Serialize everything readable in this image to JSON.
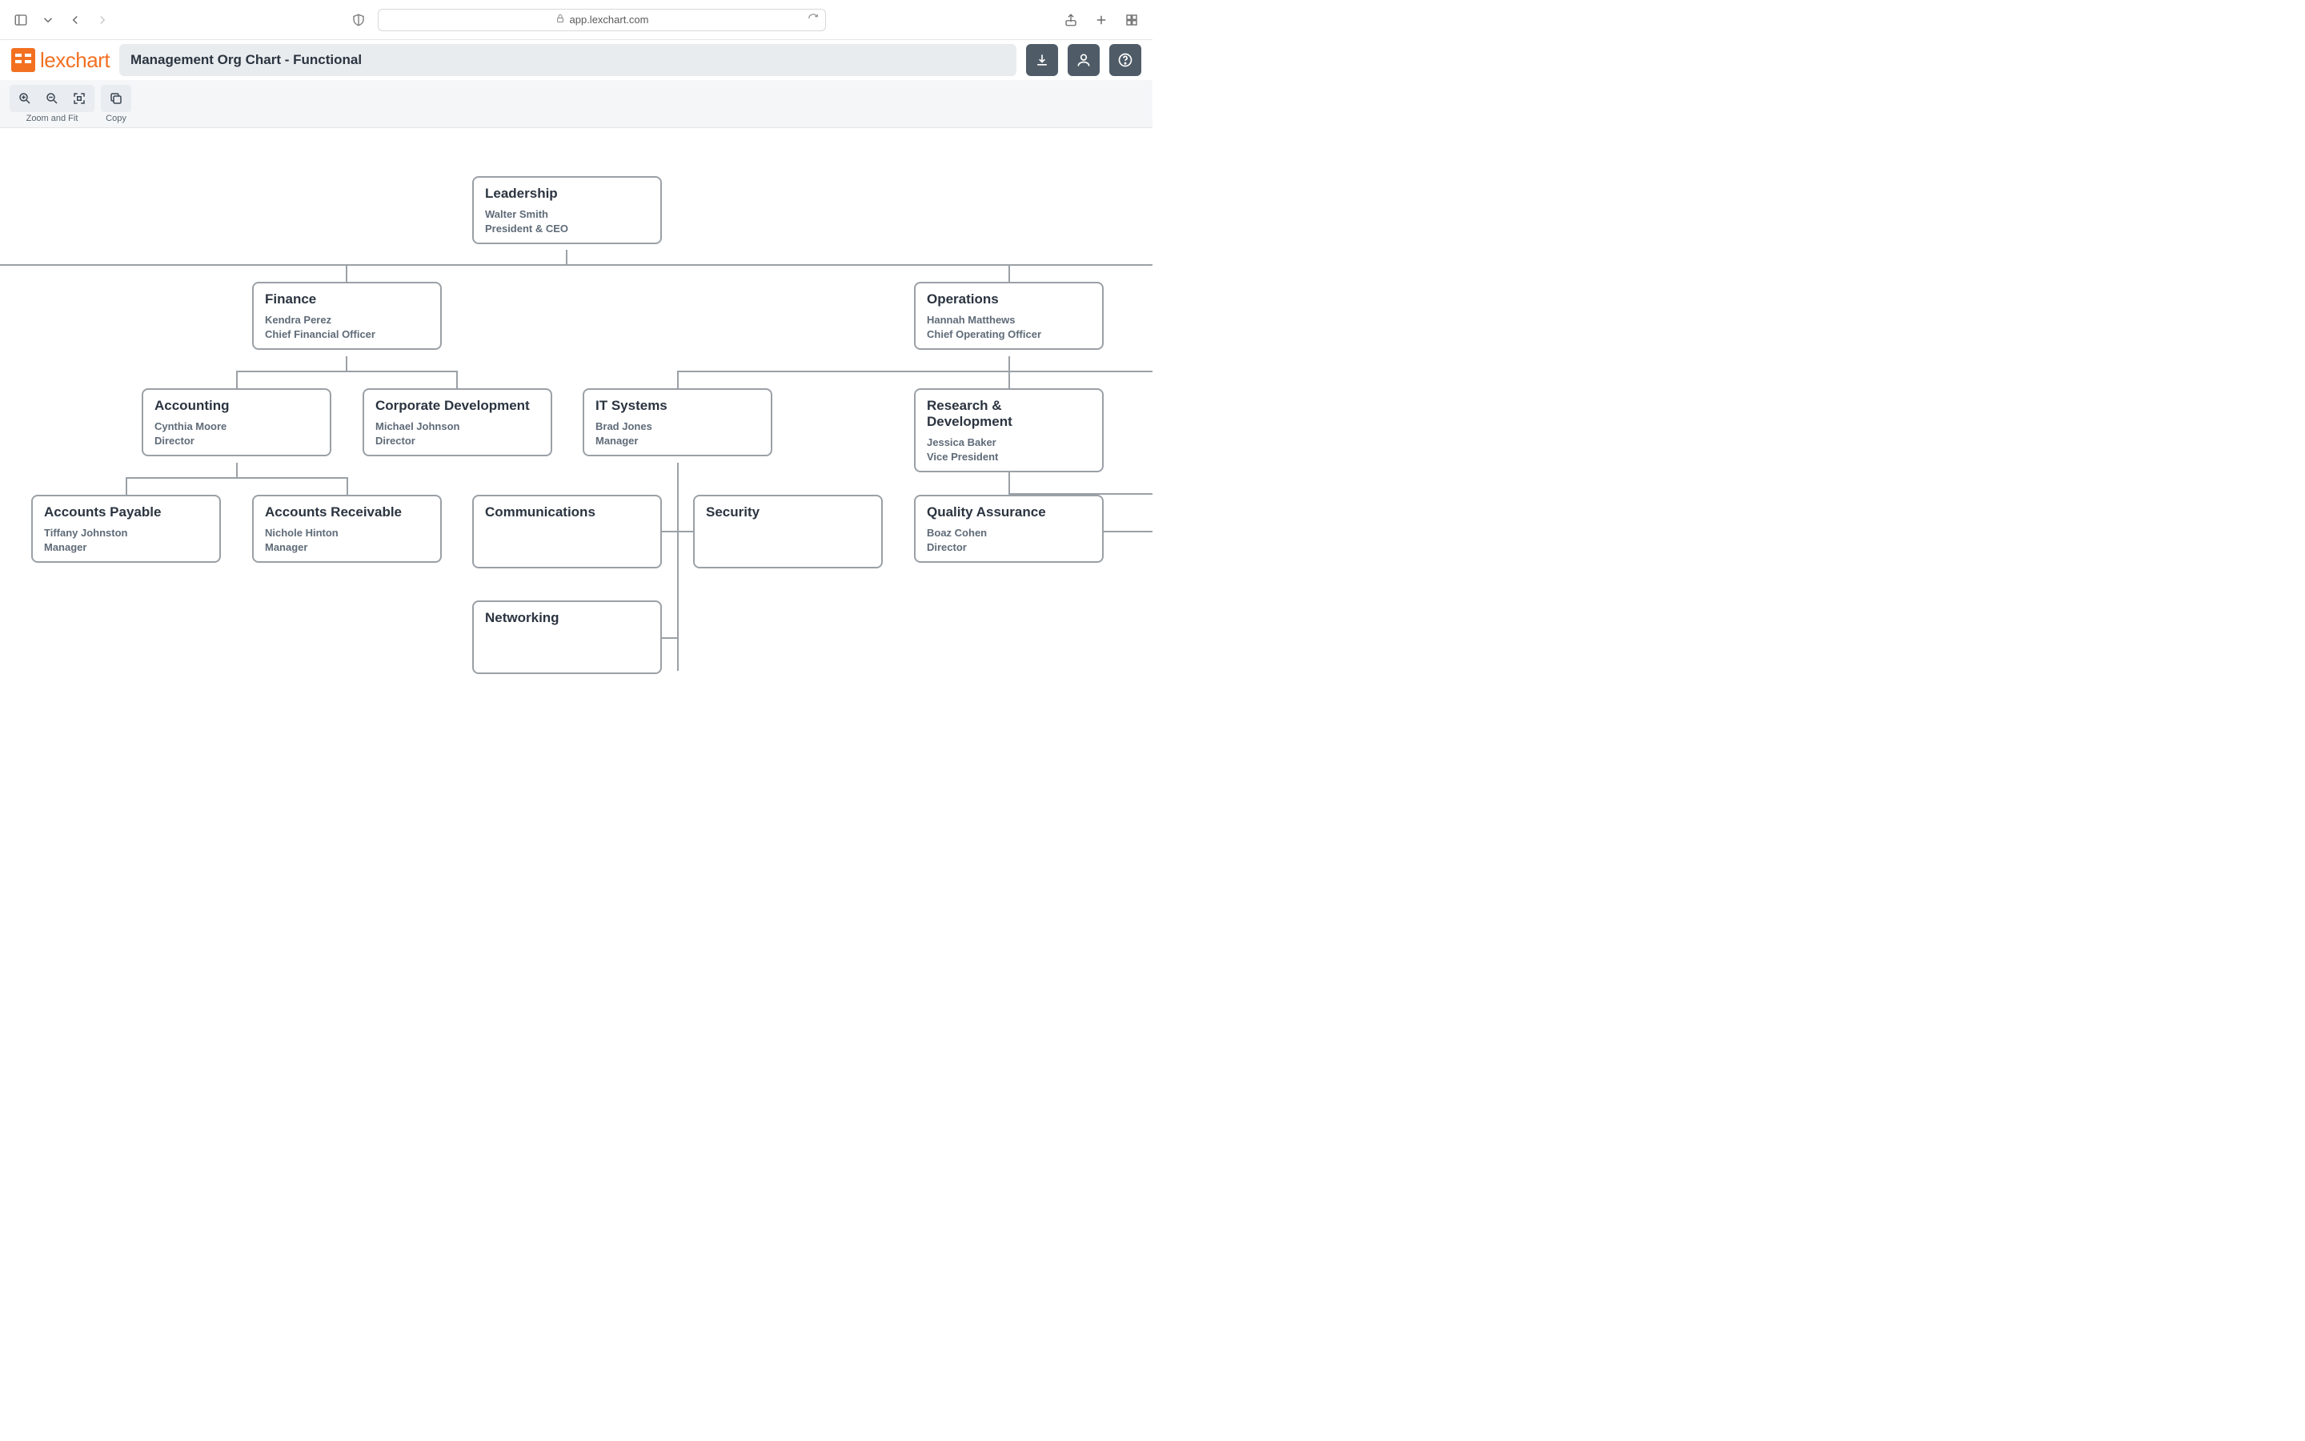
{
  "browser": {
    "url_host": "app.lexchart.com"
  },
  "app": {
    "logo_text": "lexchart",
    "title": "Management Org Chart - Functional"
  },
  "toolbar": {
    "zoom_label": "Zoom and Fit",
    "copy_label": "Copy"
  },
  "chart_data": {
    "type": "org-chart",
    "nodes": [
      {
        "id": "leadership",
        "dept": "Leadership",
        "person": "Walter Smith",
        "role": "President & CEO",
        "parent": null
      },
      {
        "id": "finance",
        "dept": "Finance",
        "person": "Kendra Perez",
        "role": "Chief Financial Officer",
        "parent": "leadership"
      },
      {
        "id": "operations",
        "dept": "Operations",
        "person": "Hannah Matthews",
        "role": "Chief Operating Officer",
        "parent": "leadership"
      },
      {
        "id": "accounting",
        "dept": "Accounting",
        "person": "Cynthia Moore",
        "role": "Director",
        "parent": "finance"
      },
      {
        "id": "corpdev",
        "dept": "Corporate Development",
        "person": "Michael Johnson",
        "role": "Director",
        "parent": "finance"
      },
      {
        "id": "it",
        "dept": "IT Systems",
        "person": "Brad Jones",
        "role": "Manager",
        "parent": "operations"
      },
      {
        "id": "rd",
        "dept": "Research & Development",
        "person": "Jessica Baker",
        "role": "Vice President",
        "parent": "operations"
      },
      {
        "id": "ap",
        "dept": "Accounts Payable",
        "person": "Tiffany Johnston",
        "role": "Manager",
        "parent": "accounting"
      },
      {
        "id": "ar",
        "dept": "Accounts Receivable",
        "person": "Nichole Hinton",
        "role": "Manager",
        "parent": "accounting"
      },
      {
        "id": "comm",
        "dept": "Communications",
        "person": "",
        "role": "",
        "parent": "it"
      },
      {
        "id": "sec",
        "dept": "Security",
        "person": "",
        "role": "",
        "parent": "it"
      },
      {
        "id": "net",
        "dept": "Networking",
        "person": "",
        "role": "",
        "parent": "it"
      },
      {
        "id": "qa",
        "dept": "Quality Assurance",
        "person": "Boaz Cohen",
        "role": "Director",
        "parent": "rd"
      }
    ]
  }
}
